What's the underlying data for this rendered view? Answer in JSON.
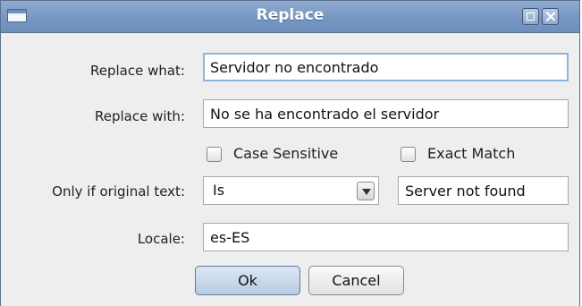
{
  "window": {
    "title": "Replace"
  },
  "form": {
    "replace_what": {
      "label": "Replace what:",
      "value": "Servidor no encontrado"
    },
    "replace_with": {
      "label": "Replace with:",
      "value": "No se ha encontrado el servidor"
    },
    "case_sensitive": {
      "label": "Case Sensitive",
      "checked": false
    },
    "exact_match": {
      "label": "Exact Match",
      "checked": false
    },
    "only_if": {
      "label": "Only if original text:",
      "operator": "Is",
      "value": "Server not found"
    },
    "locale": {
      "label": "Locale:",
      "value": "es-ES"
    }
  },
  "buttons": {
    "ok": "Ok",
    "cancel": "Cancel"
  },
  "icons": {
    "window_menu": "window-menu-icon",
    "restore": "restore-icon",
    "close": "close-icon",
    "dropdown": "chevron-down-icon"
  },
  "colors": {
    "titlebar": "#7797c3",
    "dialog_background": "#eeeeee",
    "focus_border": "#8fb3e0"
  }
}
